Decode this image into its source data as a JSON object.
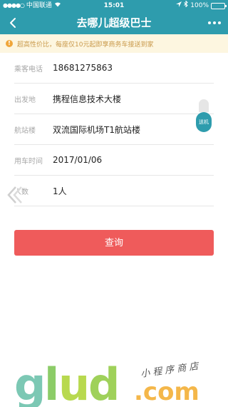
{
  "statusbar": {
    "carrier": "中国联通",
    "time": "15:01",
    "battery": "100%"
  },
  "navbar": {
    "title": "去哪儿超级巴士"
  },
  "notice": {
    "text": "超高性价比，每座仅10元起即享商务车接送到家"
  },
  "form": {
    "rows": [
      {
        "label": "乘客电话",
        "value": "18681275863"
      },
      {
        "label": "出发地",
        "value": "携程信息技术大楼"
      },
      {
        "label": "航站楼",
        "value": "双流国际机场T1航站楼"
      },
      {
        "label": "用车时间",
        "value": "2017/01/06"
      },
      {
        "label": "人数",
        "value": "1人"
      }
    ]
  },
  "side_button": {
    "label": "送机"
  },
  "query_button": {
    "label": "查询"
  },
  "watermark": {
    "brand": "glud",
    "domain": ".com",
    "tagline": "小程序商店"
  },
  "colors": {
    "primary": "#2e9cad",
    "danger": "#ef5b5b",
    "notice_bg": "#fdf6e0",
    "notice_text": "#c9994a"
  }
}
